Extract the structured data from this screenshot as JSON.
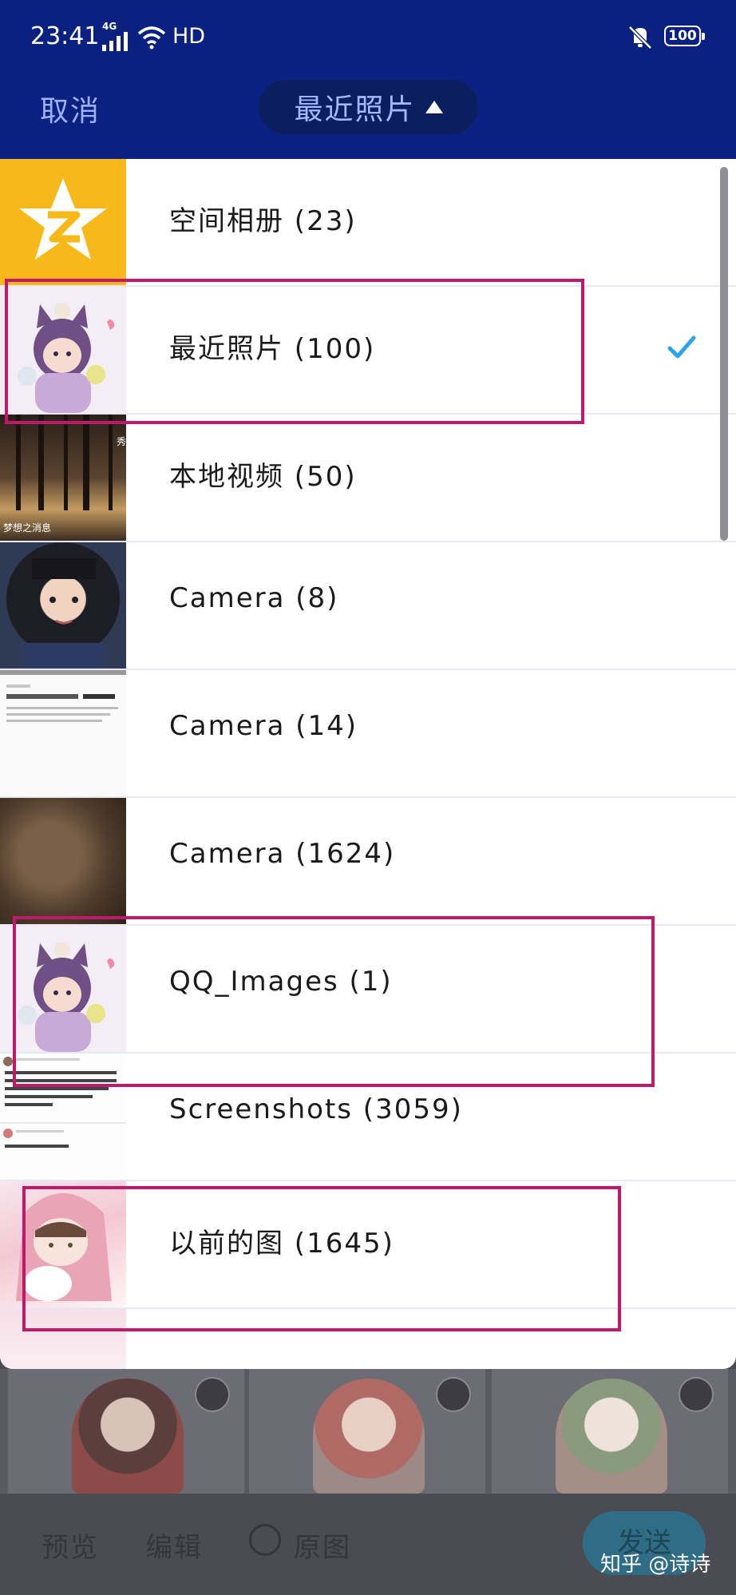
{
  "status_bar": {
    "time": "23:41",
    "network": "4G",
    "hd": "HD",
    "battery": "100"
  },
  "header": {
    "cancel_label": "取消",
    "title": "最近照片"
  },
  "albums": [
    {
      "label": "空间相册 (23)",
      "thumb": "qzone-star-icon",
      "selected": false
    },
    {
      "label": "最近照片 (100)",
      "thumb": "anime-cat-boy",
      "selected": true
    },
    {
      "label": "本地视频 (50)",
      "thumb": "forest",
      "selected": false,
      "thumb_text": "梦想之消息"
    },
    {
      "label": "Camera (8)",
      "thumb": "girl-portrait",
      "selected": false
    },
    {
      "label": "Camera (14)",
      "thumb": "text-screenshot",
      "selected": false
    },
    {
      "label": "Camera (1624)",
      "thumb": "fur",
      "selected": false
    },
    {
      "label": "QQ_Images (1)",
      "thumb": "anime-cat-boy",
      "selected": false
    },
    {
      "label": "Screenshots (3059)",
      "thumb": "chat-screenshot",
      "selected": false
    },
    {
      "label": "以前的图 (1645)",
      "thumb": "pink-hood-girl",
      "selected": false
    }
  ],
  "bottom_bar": {
    "preview_label": "预览",
    "edit_label": "编辑",
    "original_label": "原图",
    "send_label": "发送"
  },
  "watermark": "知乎 @诗诗",
  "colors": {
    "header_bg": "#0a2182",
    "highlight": "#c0186a",
    "check": "#2aa3ef"
  }
}
